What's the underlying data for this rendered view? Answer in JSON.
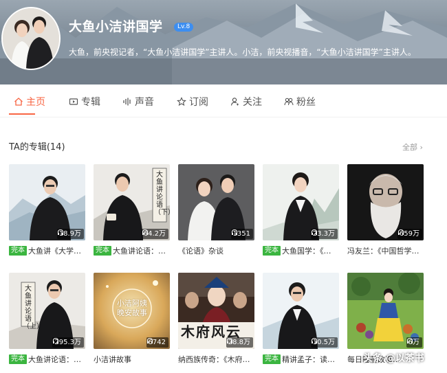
{
  "profile": {
    "title": "大鱼小洁讲国学",
    "level": "Lv.8",
    "description": "大鱼，前央视记者，“大鱼小洁讲国学”主讲人。小洁，前央视播音，“大鱼小洁讲国学”主讲人。"
  },
  "tabs": [
    {
      "label": "主页",
      "icon": "home-icon"
    },
    {
      "label": "专辑",
      "icon": "album-icon"
    },
    {
      "label": "声音",
      "icon": "sound-wave-icon"
    },
    {
      "label": "订阅",
      "icon": "star-icon"
    },
    {
      "label": "关注",
      "icon": "person-add-icon"
    },
    {
      "label": "粉丝",
      "icon": "fans-icon"
    }
  ],
  "active_tab": "主页",
  "accent_color": "#f86442",
  "section": {
    "title": "TA的专辑(14)",
    "all_label": "全部"
  },
  "albums": [
    {
      "badge": "完本",
      "title": "大鱼讲《大学…",
      "plays": "18.9万"
    },
    {
      "badge": "完本",
      "title": "大鱼讲论语：…",
      "plays": "64.2万"
    },
    {
      "badge": "",
      "title": "《论语》杂谈",
      "plays": "1351"
    },
    {
      "badge": "完本",
      "title": "大鱼国学：《…",
      "plays": "23.3万"
    },
    {
      "badge": "",
      "title": "冯友兰：《中国哲学…",
      "plays": "659万"
    },
    {
      "badge": "完本",
      "title": "大鱼讲论语：…",
      "plays": "295.3万"
    },
    {
      "badge": "",
      "title": "小洁讲故事",
      "plays": "6742"
    },
    {
      "badge": "",
      "title": "纳西族传奇：《木府…",
      "plays": "28.8万"
    },
    {
      "badge": "完本",
      "title": "精讲孟子：读…",
      "plays": "10.5万"
    },
    {
      "badge": "",
      "title": "每日睡前故事…",
      "plays": "6万"
    }
  ],
  "cover_texts": {
    "album2": "大鱼讲论语（下）",
    "album6": "大鱼讲论语（上）",
    "album7": "小洁阿姨晚安故事",
    "album8": "木府风云"
  },
  "watermark": "头条 @以茶书"
}
